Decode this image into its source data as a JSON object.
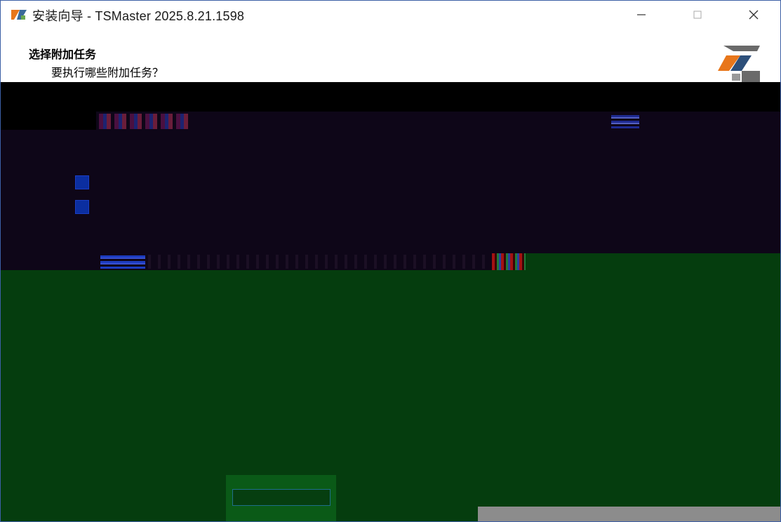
{
  "window": {
    "title": "安装向导 - TSMaster 2025.8.21.1598",
    "controls": {
      "minimize": "—",
      "maximize": "☐",
      "close": "✕"
    }
  },
  "header": {
    "title": "选择附加任务",
    "subtitle": "要执行哪些附加任务？"
  },
  "icons": {
    "app": "tsmaster-logo-icon",
    "header_logo": "tsmaster-logo-icon"
  },
  "colors": {
    "panel": "#0e0618",
    "green": "#053d0e",
    "checkbox": "#0b2ea0",
    "border": "#3c5fa6"
  }
}
